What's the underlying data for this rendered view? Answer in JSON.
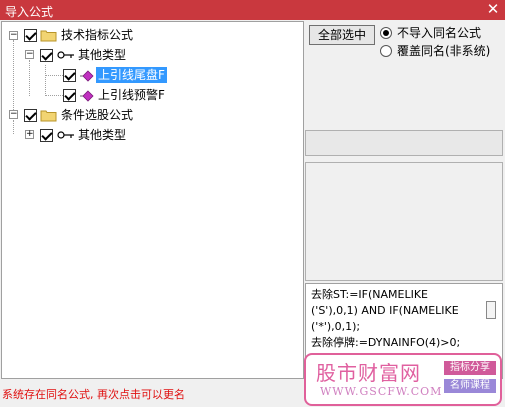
{
  "window": {
    "title": "导入公式",
    "close_glyph": "✕"
  },
  "tree": {
    "root1": {
      "label": "技术指标公式",
      "child": {
        "label": "其他类型",
        "items": [
          {
            "label": "上引线尾盘F",
            "selected": true
          },
          {
            "label": "上引线预警F",
            "selected": false
          }
        ]
      }
    },
    "root2": {
      "label": "条件选股公式",
      "child": {
        "label": "其他类型"
      }
    }
  },
  "options": {
    "select_all_label": "全部选中",
    "radio1_label": "不导入同名公式",
    "radio2_label": "覆盖同名(非系统)"
  },
  "code": {
    "lines": [
      "去除ST:=IF(NAMELIKE",
      "('S'),0,1) AND IF(NAMELIKE",
      "('*'),0,1);",
      "去除停牌:=DYNAINFO(4)>0;"
    ]
  },
  "status_text": "系统存在同名公式, 再次点击可以更名",
  "watermark": {
    "title": "股市财富网",
    "url": "WWW.GSCFW.COM",
    "tag1": "指标分享",
    "tag2": "名师课程"
  },
  "colors": {
    "titlebar": "#c9383e",
    "selection": "#3399ff",
    "status": "#e01010",
    "watermark": "#e0609a"
  }
}
